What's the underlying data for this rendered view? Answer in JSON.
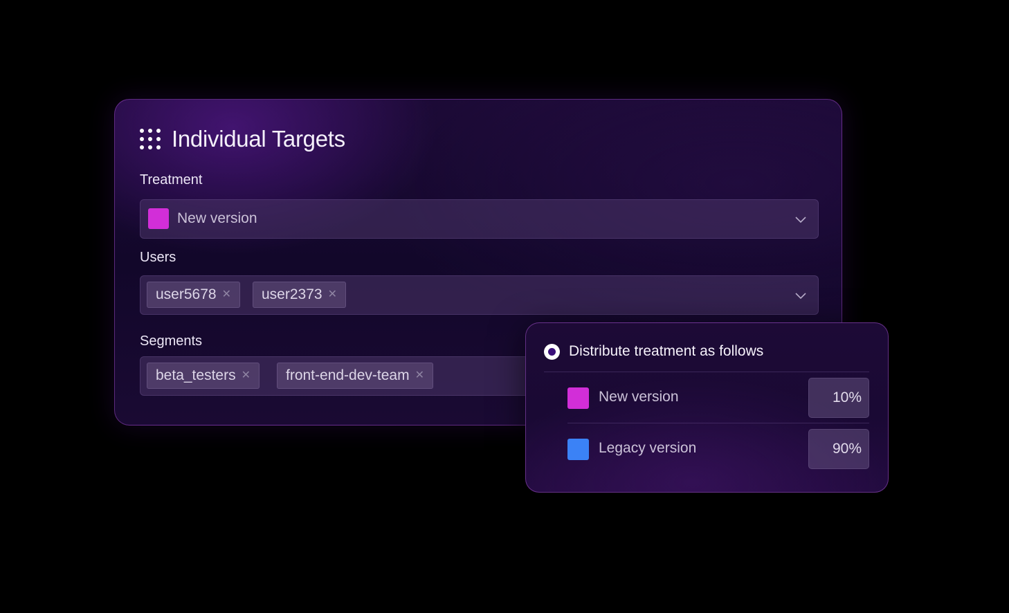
{
  "card": {
    "title": "Individual Targets",
    "title_icon": "grid-dots-icon"
  },
  "treatment": {
    "label": "Treatment",
    "selected_value": "New version",
    "selected_color": "#d22ed8",
    "dropdown_icon": "chevron-down-icon"
  },
  "users": {
    "label": "Users",
    "tags": [
      {
        "label": "user5678",
        "remove_icon": "close-icon"
      },
      {
        "label": "user2373",
        "remove_icon": "close-icon"
      }
    ],
    "dropdown_icon": "chevron-down-icon"
  },
  "segments": {
    "label": "Segments",
    "tags": [
      {
        "label": "beta_testers",
        "remove_icon": "close-icon"
      },
      {
        "label": "front-end-dev-team",
        "remove_icon": "close-icon"
      }
    ]
  },
  "distribution": {
    "title": "Distribute treatment as follows",
    "selected": true,
    "rows": [
      {
        "name": "New version",
        "color": "#d22ed8",
        "percent": "10%"
      },
      {
        "name": "Legacy version",
        "color": "#3b82f6",
        "percent": "90%"
      }
    ]
  },
  "colors": {
    "background": "#000000",
    "accent_magenta": "#d22ed8",
    "accent_blue": "#3b82f6",
    "card_border": "#9646be"
  }
}
